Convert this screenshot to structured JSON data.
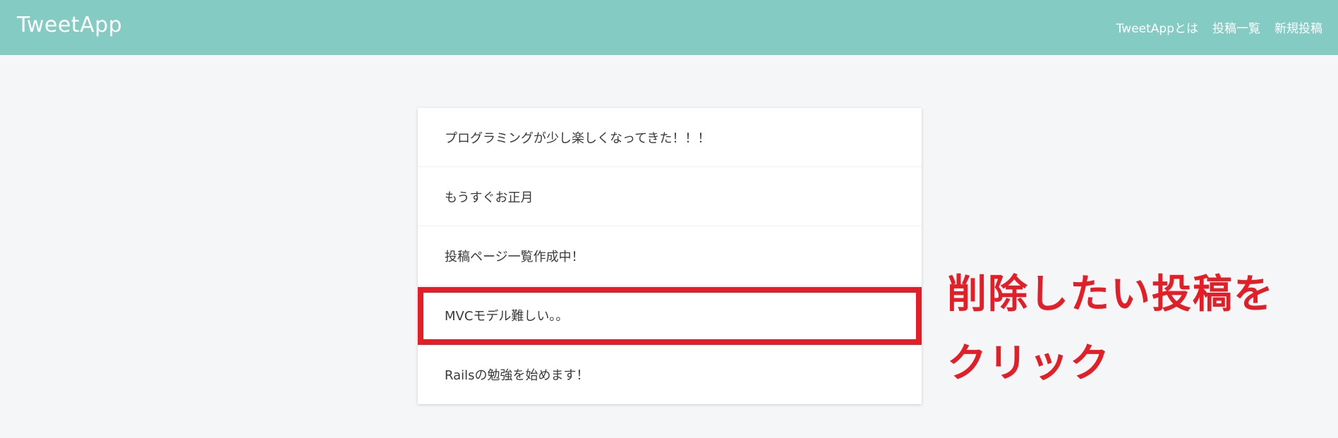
{
  "header": {
    "logo": "TweetApp",
    "nav": [
      {
        "label": "TweetAppとは"
      },
      {
        "label": "投稿一覧"
      },
      {
        "label": "新規投稿"
      }
    ]
  },
  "posts": [
    {
      "content": "プログラミングが少し楽しくなってきた！！！"
    },
    {
      "content": "もうすぐお正月"
    },
    {
      "content": "投稿ページ一覧作成中！"
    },
    {
      "content": "MVCモデル難しい。。"
    },
    {
      "content": "Railsの勉強を始めます！"
    }
  ],
  "annotation": {
    "line1": "削除したい投稿を",
    "line2": "クリック",
    "color": "#e41e26"
  },
  "colors": {
    "header_bg": "#83cbc3",
    "page_bg": "#f5f6f8",
    "highlight": "#e41e26"
  }
}
